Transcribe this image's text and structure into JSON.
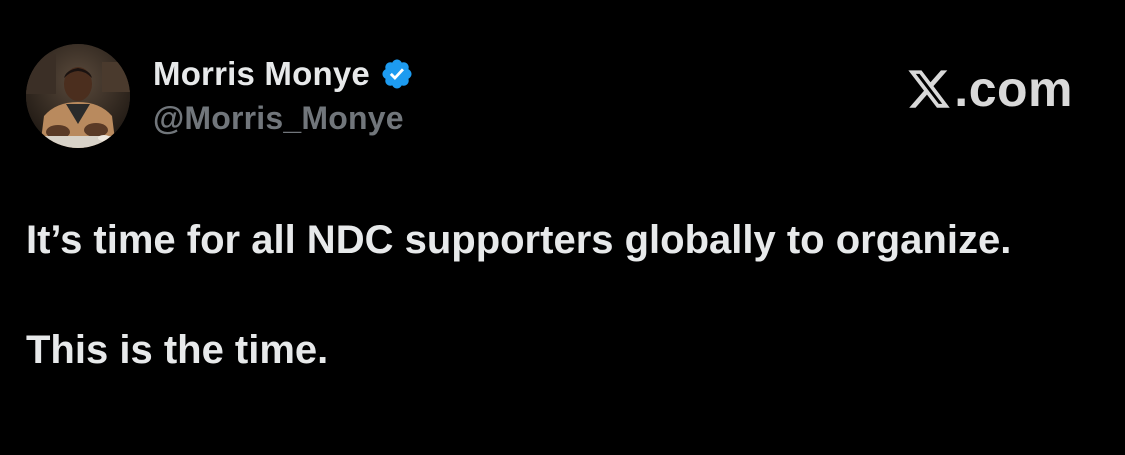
{
  "author": {
    "display_name": "Morris Monye",
    "handle": "@Morris_Monye",
    "verified": true
  },
  "watermark": {
    "site": ".com",
    "logo_icon": "x-logo-icon"
  },
  "tweet": {
    "paragraphs": [
      "It’s time for all NDC supporters globally to organize.",
      "This is the time."
    ]
  },
  "colors": {
    "background": "#000000",
    "text_primary": "#e7e9ea",
    "text_secondary": "#71767b",
    "verified_blue": "#1d9bf0",
    "watermark": "#d9d9d9"
  }
}
